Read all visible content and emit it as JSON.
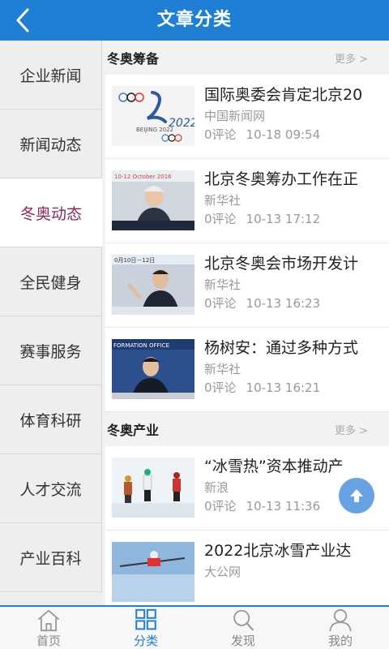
{
  "header": {
    "title": "文章分类",
    "back_icon": "back-arrow-icon"
  },
  "sidebar": {
    "items": [
      {
        "label": "企业新闻",
        "active": false
      },
      {
        "label": "新闻动态",
        "active": false
      },
      {
        "label": "冬奥动态",
        "active": true
      },
      {
        "label": "全民健身",
        "active": false
      },
      {
        "label": "赛事服务",
        "active": false
      },
      {
        "label": "体育科研",
        "active": false
      },
      {
        "label": "人才交流",
        "active": false
      },
      {
        "label": "产业百科",
        "active": false
      }
    ]
  },
  "sections": [
    {
      "title": "冬奥筹备",
      "more": "更多 >",
      "articles": [
        {
          "title": "国际奥委会肯定北京20",
          "source": "中国新闻网",
          "comments": "0评论",
          "time": "10-18 09:54",
          "thumb_text": "BEIJING 2022"
        },
        {
          "title": "北京冬奥筹办工作在正",
          "source": "新华社",
          "comments": "0评论",
          "time": "10-13 17:12",
          "thumb_text": "10-12 October 2016"
        },
        {
          "title": "北京冬奥会市场开发计",
          "source": "新华社",
          "comments": "0评论",
          "time": "10-13 16:23",
          "thumb_text": "0月10日－12日"
        },
        {
          "title": "杨树安：通过多种方式",
          "source": "新华社",
          "comments": "0评论",
          "time": "10-13 16:21",
          "thumb_text": "FORMATION OFFICE"
        }
      ]
    },
    {
      "title": "冬奥产业",
      "more": "更多 >",
      "articles": [
        {
          "title": "“冰雪热”资本推动产",
          "source": "新浪",
          "comments": "0评论",
          "time": "10-13 11:36"
        },
        {
          "title": "2022北京冰雪产业达",
          "source": "大公网",
          "comments": "",
          "time": ""
        }
      ]
    }
  ],
  "tabbar": {
    "items": [
      {
        "label": "首页",
        "icon": "home-icon",
        "active": false
      },
      {
        "label": "分类",
        "icon": "grid-icon",
        "active": true
      },
      {
        "label": "发现",
        "icon": "search-icon",
        "active": false
      },
      {
        "label": "我的",
        "icon": "user-icon",
        "active": false
      }
    ]
  },
  "colors": {
    "primary": "#1f7fd4",
    "active_sidebar_text": "#8a2a5a"
  }
}
